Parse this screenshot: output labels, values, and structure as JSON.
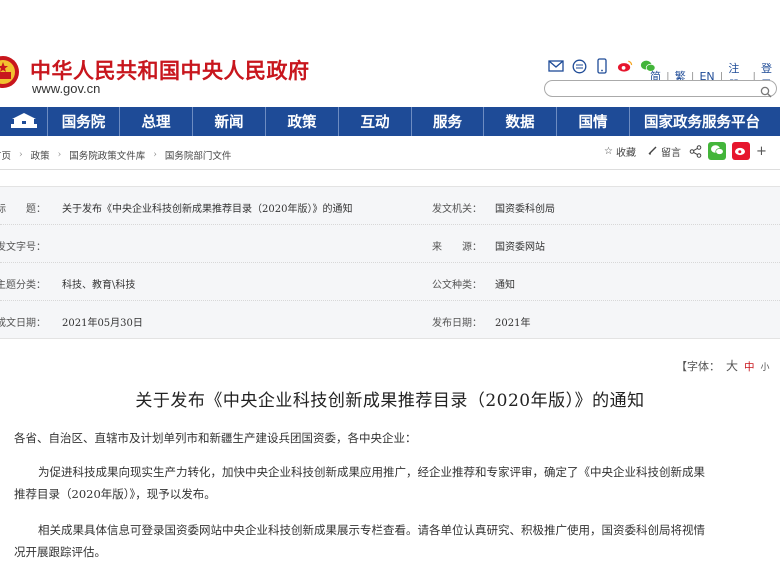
{
  "site": {
    "title": "中华人民共和国中央人民政府",
    "url": "www.gov.cn"
  },
  "top_links": [
    "简",
    "繁",
    "EN",
    "注册",
    "登录"
  ],
  "top_icons": [
    "mail-icon",
    "message-icon",
    "mobile-icon",
    "weibo-icon",
    "wechat-icon"
  ],
  "search": {
    "value": ""
  },
  "nav": {
    "home_icon": "tiananmen-home-icon",
    "items": [
      "国务院",
      "总理",
      "新闻",
      "政策",
      "互动",
      "服务",
      "数据",
      "国情",
      "国家政务服务平台"
    ]
  },
  "breadcrumb": [
    "首页",
    "政策",
    "国务院政策文件库",
    "国务院部门文件"
  ],
  "tools": {
    "favorite": "收藏",
    "comment": "留言",
    "share_icon": "share-icon",
    "wechat_icon": "wechat-icon",
    "weibo_icon": "weibo-icon",
    "plus": "+"
  },
  "info": {
    "title_label": "标　　题：",
    "title_value": "关于发布《中央企业科技创新成果推荐目录（2020年版）》的通知",
    "issuer_label": "发文机关：",
    "issuer_value": "国资委科创局",
    "docno_label": "发文字号：",
    "docno_value": "",
    "source_label": "来　　源：",
    "source_value": "国资委网站",
    "topic_label": "主题分类：",
    "topic_value": "科技、教育\\科技",
    "doctype_label": "公文种类：",
    "doctype_value": "通知",
    "date_label": "成文日期：",
    "date_value": "2021年05月30日",
    "pubdate_label": "发布日期：",
    "pubdate_value": "2021年"
  },
  "font_size": {
    "prefix": "【字体：",
    "large": "大",
    "medium": "中",
    "small": "小"
  },
  "article": {
    "title": "关于发布《中央企业科技创新成果推荐目录（2020年版）》的通知",
    "salutation": "各省、自治区、直辖市及计划单列市和新疆生产建设兵团国资委，各中央企业：",
    "p1_line1": "为促进科技成果向现实生产力转化，加快中央企业科技创新成果应用推广，经企业推荐和专家评审，确定了《中央企业科技创新成果",
    "p1_line2": "推荐目录（2020年版）》，现予以发布。",
    "p2_line1": "相关成果具体信息可登录国资委网站中央企业科技创新成果展示专栏查看。请各单位认真研究、积极推广使用，国资委科创局将视情",
    "p2_line2": "况开展跟踪评估。"
  },
  "colors": {
    "brand_red": "#c8161d",
    "nav_blue": "#1e4b97",
    "info_bg": "#f5f6f8",
    "wechat_green": "#43b53a",
    "weibo_red": "#e6162d"
  }
}
